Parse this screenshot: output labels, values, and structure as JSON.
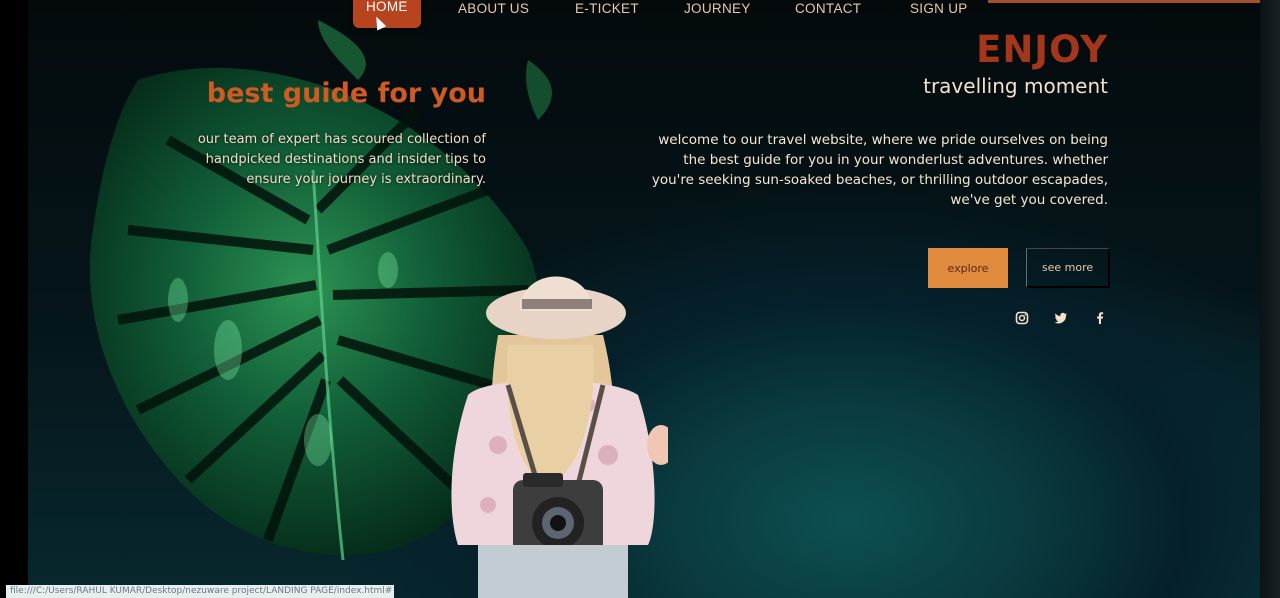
{
  "nav": {
    "items": [
      {
        "label": "HOME",
        "active": true
      },
      {
        "label": "ABOUT US"
      },
      {
        "label": "E-TICKET"
      },
      {
        "label": "JOURNEY"
      },
      {
        "label": "CONTACT"
      },
      {
        "label": "SIGN UP"
      }
    ]
  },
  "left": {
    "heading": "best guide for you",
    "paragraph": "our team of expert has scoured collection of handpicked destinations and insider tips to ensure your journey is extraordinary."
  },
  "hero": {
    "title": "ENJOY",
    "tagline": "travelling moment",
    "welcome": "welcome to our travel website, where we pride ourselves on being the best guide for you in your wonderlust adventures. whether you're seeking sun-soaked beaches, or thrilling outdoor escapades, we've get you covered."
  },
  "buttons": {
    "explore": "explore",
    "see_more": "see more"
  },
  "social": {
    "icons": [
      "instagram-icon",
      "twitter-icon",
      "facebook-icon"
    ]
  },
  "status_bar": {
    "url": "file:///C:/Users/RAHUL KUMAR/Desktop/nezuware project/LANDING PAGE/index.html#"
  },
  "colors": {
    "accent": "#cf5a22",
    "enjoy": "#a3361b",
    "explore_button": "#e08a3e",
    "nav_active": "#b7441f",
    "nav_text": "#e9c7a5"
  }
}
